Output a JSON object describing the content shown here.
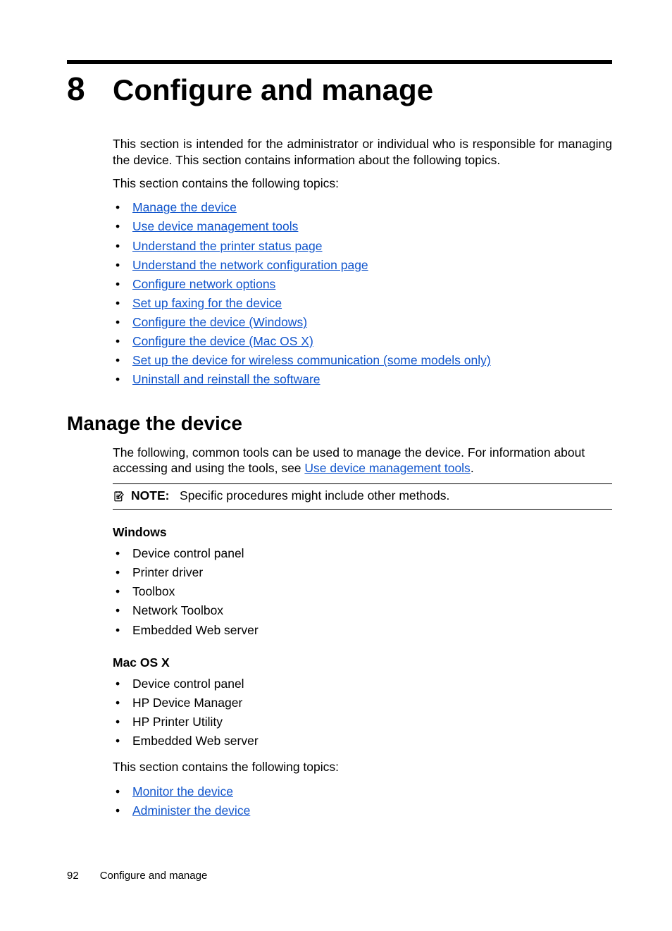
{
  "chapter": {
    "number": "8",
    "title": "Configure and manage"
  },
  "intro1": "This section is intended for the administrator or individual who is responsible for managing the device. This section contains information about the following topics.",
  "intro2": "This section contains the following topics:",
  "links1": [
    "Manage the device",
    "Use device management tools",
    "Understand the printer status page",
    "Understand the network configuration page",
    "Configure network options",
    "Set up faxing for the device",
    "Configure the device (Windows)",
    "Configure the device (Mac OS X)",
    "Set up the device for wireless communication (some models only)",
    "Uninstall and reinstall the software"
  ],
  "h2": "Manage the device",
  "managePara": {
    "pre": "The following, common tools can be used to manage the device. For information about accessing and using the tools, see ",
    "link": "Use device management tools",
    "post": "."
  },
  "note": {
    "label": "NOTE:",
    "text": "Specific procedures might include other methods."
  },
  "winHead": "Windows",
  "winList": [
    "Device control panel",
    "Printer driver",
    "Toolbox",
    "Network Toolbox",
    "Embedded Web server"
  ],
  "macHead": "Mac OS X",
  "macList": [
    "Device control panel",
    "HP Device Manager",
    "HP Printer Utility",
    "Embedded Web server"
  ],
  "topicsPara": "This section contains the following topics:",
  "links2": [
    "Monitor the device",
    "Administer the device"
  ],
  "footer": {
    "page": "92",
    "title": "Configure and manage"
  }
}
